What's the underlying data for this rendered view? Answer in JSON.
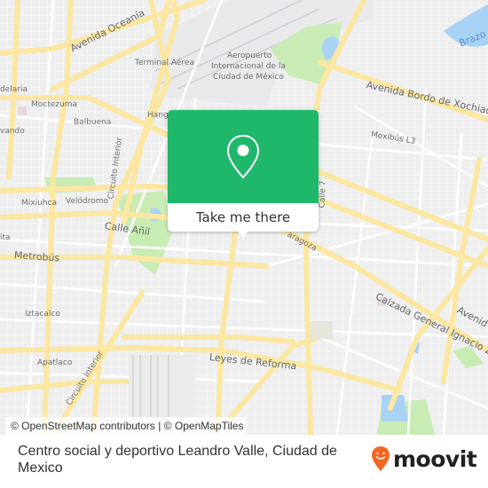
{
  "map": {
    "labels": {
      "avenida_oceania": "Avenida Oceanía",
      "terminal_aerea": "Terminal Aérea",
      "aeropuerto_1": "Aeropuerto",
      "aeropuerto_2": "Internacional de la",
      "aeropuerto_3": "Ciudad de México",
      "bordo_xochiaca": "Avenida Bordo de Xochiaca",
      "brazo": "Brazo",
      "candelaria": "delaria",
      "moctezuma": "Moctezuma",
      "balbuena": "Balbuena",
      "hangares": "Hanga",
      "alvaro": "vando",
      "mexibus": "Mexibús L3",
      "circuito_interior_top": "Circuito Interior",
      "mixiuhca": "Mixiuhca",
      "velodromo": "Velódromo",
      "calle_anil": "Calle Añil",
      "calle_7": "Calle 7",
      "zaragoza": "aragoza",
      "metrobus": "Metrobús",
      "ita": "ita",
      "iztacalco": "Iztacalco",
      "apatlaco": "Apatlaco",
      "circuito_interior_bottom": "Circuito Interior",
      "leyes_reforma": "Leyes de Reforma",
      "calzada_zaragoza": "Calzada General Ignacio Zara",
      "avenida_right": "Avenid"
    },
    "attribution": "© OpenStreetMap contributors | © OpenMapTiles"
  },
  "popup": {
    "icon": "map-pin-icon",
    "button_label": "Take me there"
  },
  "footer": {
    "place_name": "Centro social y deportivo Leandro Valle, Ciudad de Mexico",
    "brand": "moovit",
    "brand_color": "#f26722"
  },
  "colors": {
    "popup_green": "#1fb86a",
    "road_yellow": "#fbe7a1",
    "park_green": "#c9ecb4",
    "water_blue": "#a9d3f5"
  }
}
